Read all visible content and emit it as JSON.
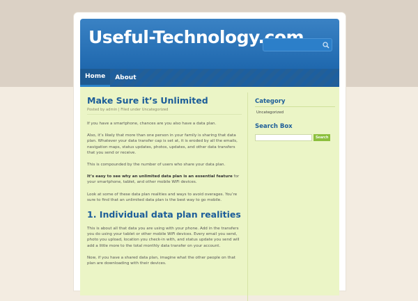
{
  "site": {
    "title": "Useful-Technology.com"
  },
  "search": {
    "placeholder": ""
  },
  "nav": {
    "items": [
      {
        "label": "Home"
      },
      {
        "label": "About"
      }
    ]
  },
  "post": {
    "title": "Make Sure it’s Unlimited",
    "meta": "Posted by admin | Filed under Uncategorized",
    "p1": "If you have a smartphone, chances are you also have a data plan.",
    "p2": "Also, it’s likely that more than one person in your family is sharing that data plan. Whatever your data transfer cap is set at, it is eroded by all the emails, navigation maps, status updates, photos, updates, and other data transfers that you send or receive.",
    "p3": "This is compounded by the number of users who share your data plan.",
    "p4_bold": "It’s easy to see why an unlimited data plan is an essential feature",
    "p4_rest": " for your smartphone, tablet, and other mobile WiFi devices.",
    "p5": "Look at some of these data plan realities and ways to avoid overages. You’re sure to find that an unlimited data plan is the best way to go mobile.",
    "section_title": "1. Individual data plan realities",
    "p6": "This is about all that data you are using with your phone. Add in the transfers you do using your tablet or other mobile WiFi devices. Every email you send, photo you upload, location you check-in with, and status update you send will add a little more to the total monthly data transfer on your account.",
    "p7": "Now, if you have a shared data plan, imagine what the other people on that plan are downloading with their devices."
  },
  "sidebar": {
    "category_heading": "Category",
    "category_item": "Uncategorized",
    "search_heading": "Search Box",
    "search_button": "Search"
  },
  "colors": {
    "header_blue": "#2470b6",
    "content_bg": "#ebf5c6",
    "heading_blue": "#1c5d99",
    "button_green": "#8bbf3d"
  }
}
